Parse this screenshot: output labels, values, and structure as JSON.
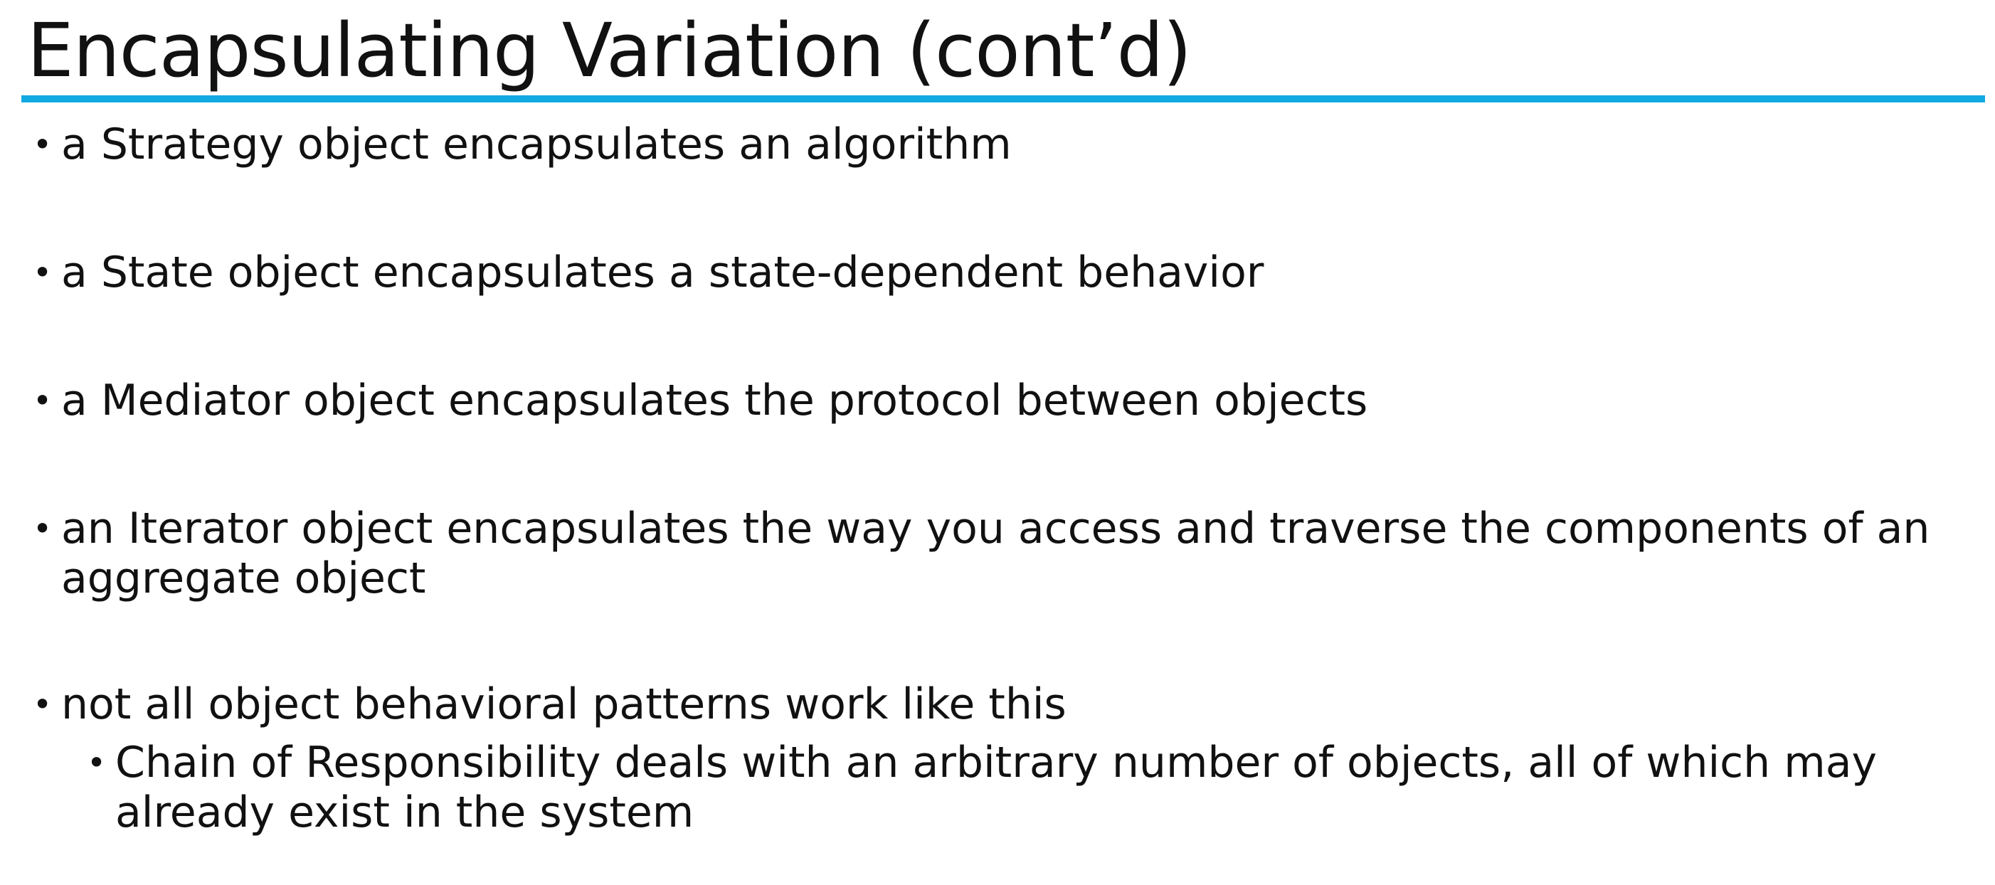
{
  "slide": {
    "title": "Encapsulating Variation (cont’d)",
    "accent_color": "#12a9e2",
    "bullets": [
      {
        "text": "a Strategy object encapsulates an algorithm"
      },
      {
        "text": "a State object encapsulates a state-dependent behavior"
      },
      {
        "text": "a Mediator object encapsulates the protocol between objects"
      },
      {
        "text": "an Iterator object encapsulates the way you access and traverse the components of an aggregate object"
      },
      {
        "text": "not all object behavioral patterns work like this"
      }
    ],
    "sub_bullets": [
      {
        "text": "Chain of Responsibility deals with an arbitrary number of objects, all of which may already exist in the system"
      }
    ],
    "bullet_symbol": "•"
  }
}
